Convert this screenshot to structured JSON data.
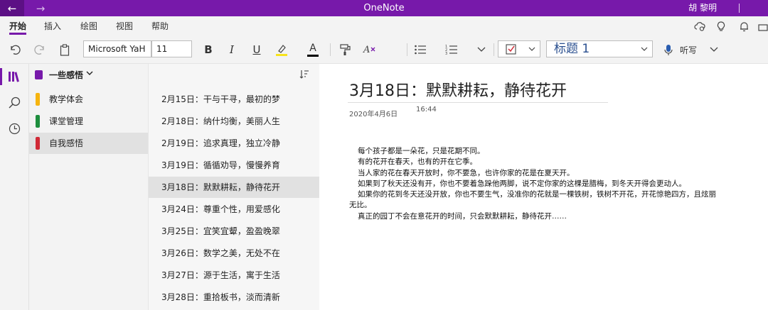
{
  "window": {
    "app_title": "OneNote",
    "user_name": "胡 黎明",
    "back_icon": "←",
    "forward_icon": "→"
  },
  "ribbon": {
    "tabs": [
      {
        "label": "开始",
        "active": true
      },
      {
        "label": "插入"
      },
      {
        "label": "绘图"
      },
      {
        "label": "视图"
      },
      {
        "label": "帮助"
      }
    ]
  },
  "toolbar": {
    "font_name": "Microsoft YaH",
    "font_size": "11",
    "bold": "B",
    "italic": "I",
    "underline": "U",
    "font_color_letter": "A",
    "style": "标题 1",
    "dictate": "听写",
    "highlight_color": "#F7E31B",
    "font_color": "#000000"
  },
  "notebook": {
    "name": "一些感悟"
  },
  "sections": [
    {
      "label": "教学体会",
      "color": "#F6B40F"
    },
    {
      "label": "课堂管理",
      "color": "#1E8E3E"
    },
    {
      "label": "自我感悟",
      "color": "#D02A36",
      "selected": true
    }
  ],
  "pages": [
    {
      "label": "2月15日：干与干寻，最初的梦"
    },
    {
      "label": "2月18日：纳什均衡，美丽人生"
    },
    {
      "label": "2月19日：追求真理，独立冷静"
    },
    {
      "label": "3月19日：循循劝导，慢慢养育"
    },
    {
      "label": "3月18日：默默耕耘，静待花开",
      "selected": true
    },
    {
      "label": "3月24日：尊重个性，用爱感化"
    },
    {
      "label": "3月25日：宜笑宜颦，盈盈晚翠"
    },
    {
      "label": "3月26日：数学之美，无处不在"
    },
    {
      "label": "3月27日：源于生活，寓于生活"
    },
    {
      "label": "3月28日：重拾板书，淡而清新"
    }
  ],
  "note": {
    "title": "3月18日：默默耕耘，静待花开",
    "date": "2020年4月6日",
    "time": "16:44",
    "paragraphs": [
      "每个孩子都是一朵花，只是花期不同。",
      "有的花开在春天，也有的开在它季。",
      "当人家的花在春天开放时，你不要急，也许你家的花是在夏天开。",
      "如果到了秋天还没有开，你也不要着急跺他两脚，说不定你家的这棵是腊梅，到冬天开得会更动人。",
      "如果你的花到冬天还没开放，你也不要生气，没准你的花就是一棵铁树，铁树不开花，开花惊艳四方，且炫丽无比。",
      "真正的园丁不会在意花开的时间，只会默默耕耘，静待花开……"
    ]
  },
  "accent_color": "#7719AA"
}
